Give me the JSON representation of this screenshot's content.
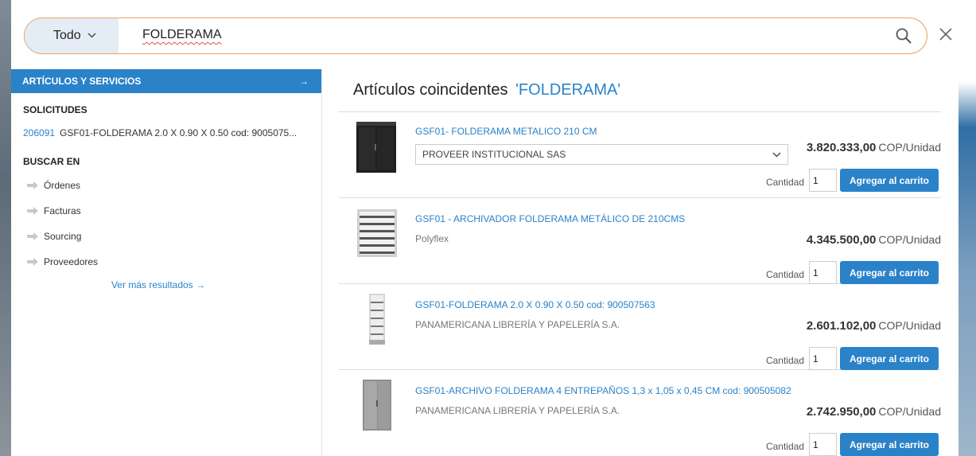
{
  "search": {
    "scope": "Todo",
    "query": "FOLDERAMA"
  },
  "left": {
    "articles_header": "ARTÍCULOS Y SERVICIOS",
    "articles_arrow": "→",
    "solicitudes_title": "SOLICITUDES",
    "solicitud": {
      "id": "206091",
      "text": "GSF01-FOLDERAMA 2.0 X 0.90 X 0.50 cod: 9005075..."
    },
    "buscar_title": "BUSCAR EN",
    "buscar_items": [
      "Órdenes",
      "Facturas",
      "Sourcing",
      "Proveedores"
    ],
    "more_results": "Ver más resultados →"
  },
  "results": {
    "title": "Artículos coincidentes",
    "query_quoted": "'FOLDERAMA'",
    "qty_label": "Cantidad",
    "add_label": "Agregar al carrito",
    "items": [
      {
        "title": "GSF01- FOLDERAMA METALICO 210 CM",
        "supplier": "PROVEER INSTITUCIONAL SAS",
        "price": "3.820.333,00",
        "unit": "COP/Unidad",
        "qty": "1"
      },
      {
        "title": "GSF01 - ARCHIVADOR FOLDERAMA METÁLICO DE 210CMS",
        "supplier": "Polyflex",
        "price": "4.345.500,00",
        "unit": "COP/Unidad",
        "qty": "1"
      },
      {
        "title": "GSF01-FOLDERAMA 2.0 X 0.90 X 0.50 cod: 900507563",
        "supplier": "PANAMERICANA LIBRERÍA Y PAPELERÍA S.A.",
        "price": "2.601.102,00",
        "unit": "COP/Unidad",
        "qty": "1"
      },
      {
        "title": "GSF01-ARCHIVO FOLDERAMA 4 ENTREPAÑOS 1,3 x 1,05 x 0,45 CM cod: 900505082",
        "supplier": "PANAMERICANA LIBRERÍA Y PAPELERÍA S.A.",
        "price": "2.742.950,00",
        "unit": "COP/Unidad",
        "qty": "1"
      }
    ]
  },
  "colors": {
    "accent": "#2a82c9",
    "search_border": "#e9a25f",
    "scope_bg": "#e4edf6"
  }
}
